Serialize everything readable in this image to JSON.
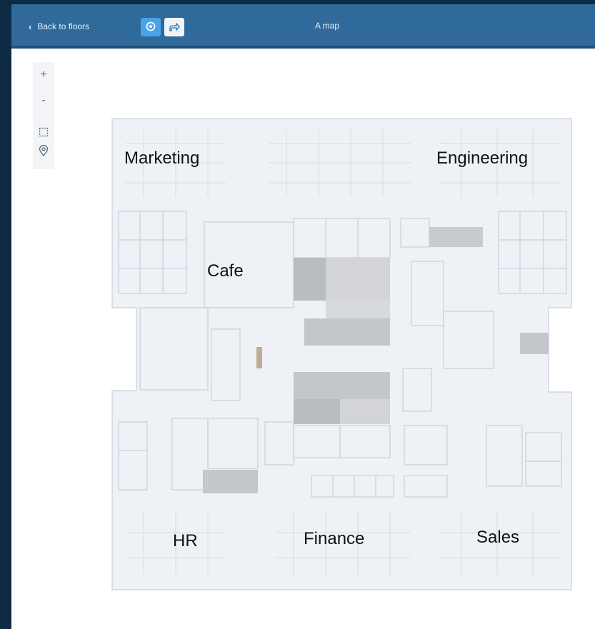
{
  "header": {
    "back_label": "Back to floors",
    "map_title": "A map",
    "pin_icon": "location-pin-icon",
    "share_icon": "share-arrow-icon"
  },
  "toolbar": {
    "zoom_in": "+",
    "zoom_out": "-",
    "select_icon": "area-select-icon",
    "pin_icon": "location-pin-icon"
  },
  "map": {
    "labels": {
      "marketing": "Marketing",
      "engineering": "Engineering",
      "cafe": "Cafe",
      "hr": "HR",
      "finance": "Finance",
      "sales": "Sales"
    }
  },
  "colors": {
    "background": "#0f2a44",
    "header": "#2f6a9a",
    "floor": "#eef1f6",
    "wall": "#c9d0d9",
    "room_dark": "#b9bcc1",
    "room_mid": "#cfd2d6",
    "accent": "#4aa3e6"
  }
}
